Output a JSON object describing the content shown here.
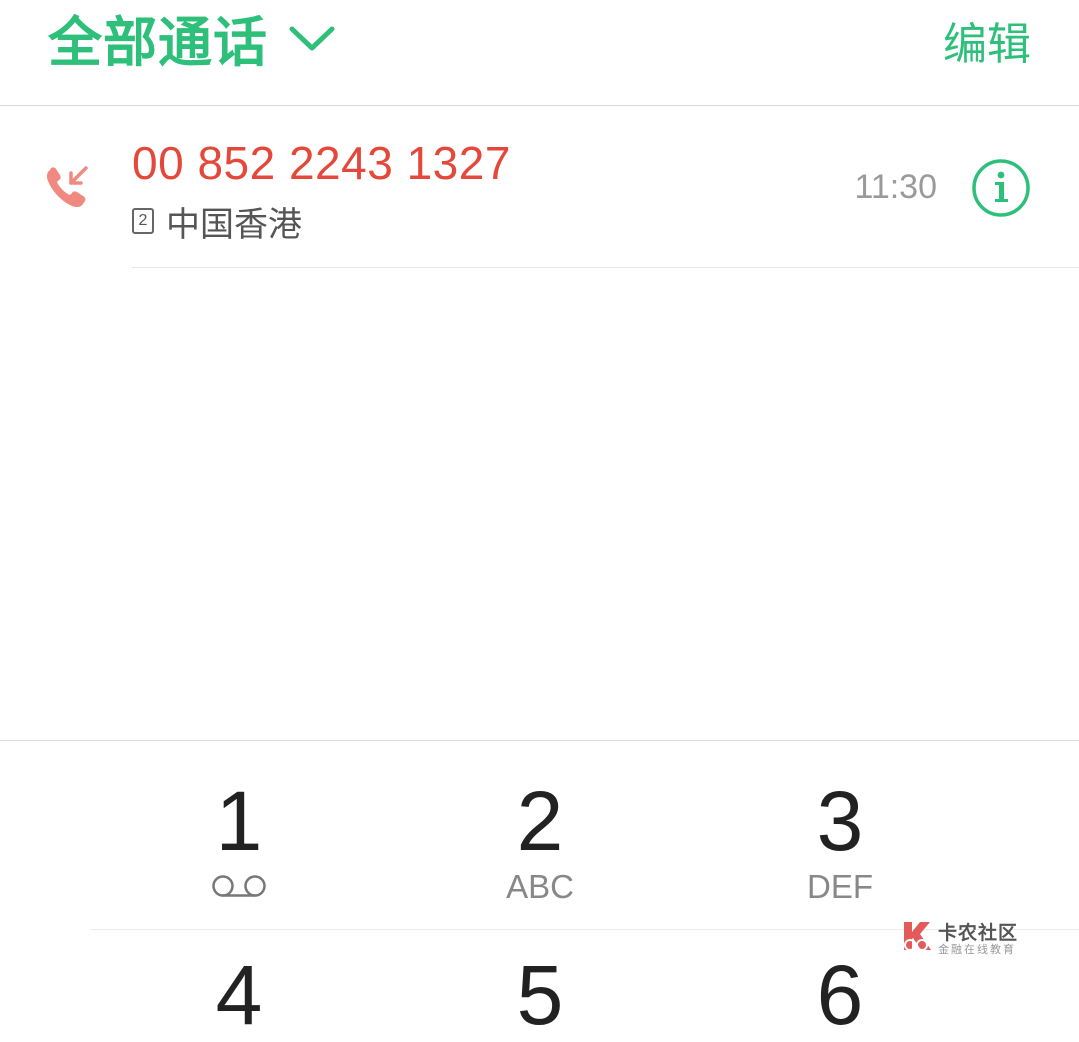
{
  "header": {
    "filter_title": "全部通话",
    "edit_label": "编辑"
  },
  "calls": [
    {
      "number": "00 852 2243 1327",
      "sim": "2",
      "location": "中国香港",
      "time": "11:30",
      "type": "incoming"
    }
  ],
  "dialpad": {
    "keys": [
      {
        "digit": "1",
        "letters": ""
      },
      {
        "digit": "2",
        "letters": "ABC"
      },
      {
        "digit": "3",
        "letters": "DEF"
      },
      {
        "digit": "4",
        "letters": ""
      },
      {
        "digit": "5",
        "letters": ""
      },
      {
        "digit": "6",
        "letters": ""
      }
    ]
  },
  "watermark": {
    "title": "卡农社区",
    "subtitle": "金融在线教育"
  },
  "colors": {
    "accent": "#2ebf7a",
    "incoming_number": "#e4483a",
    "incoming_icon": "#f08a80"
  }
}
